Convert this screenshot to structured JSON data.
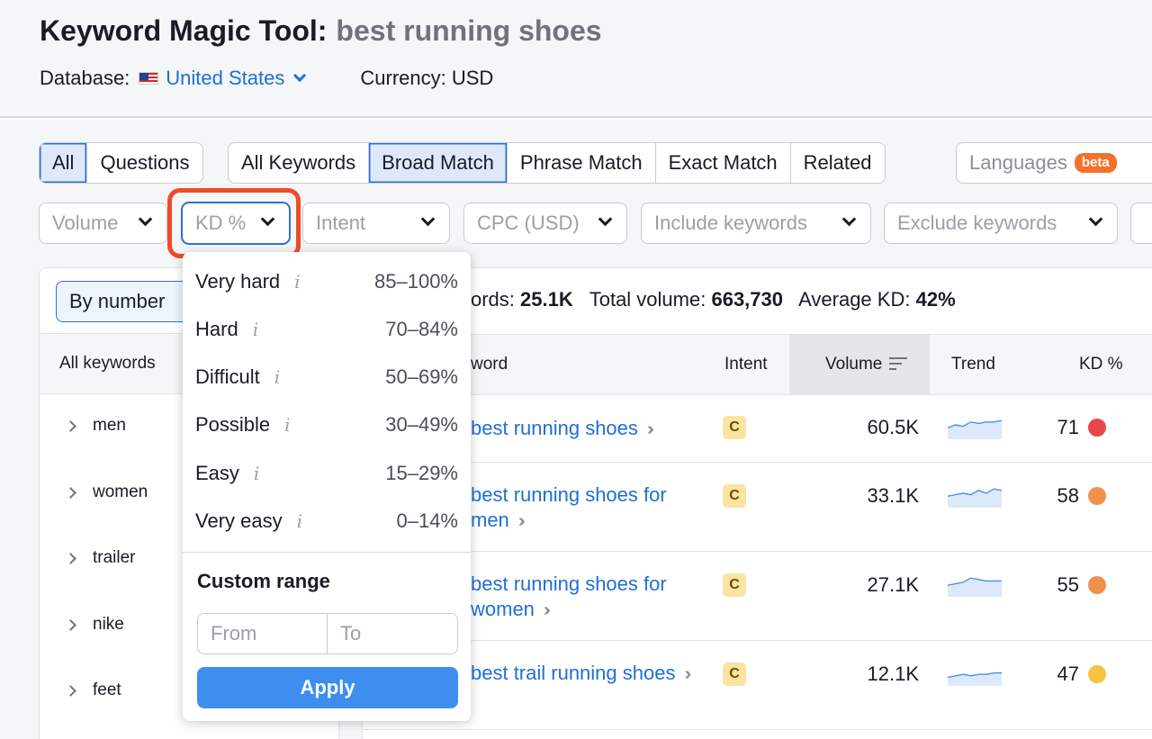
{
  "header": {
    "title": "Keyword Magic Tool:",
    "query": "best running shoes",
    "database_label": "Database:",
    "database_value": "United States",
    "currency": "Currency: USD"
  },
  "question_toggle": [
    "All",
    "Questions"
  ],
  "match_tabs": [
    "All Keywords",
    "Broad Match",
    "Phrase Match",
    "Exact Match",
    "Related"
  ],
  "languages": {
    "label": "Languages",
    "badge": "beta"
  },
  "filters": {
    "volume": "Volume",
    "kd": "KD %",
    "intent": "Intent",
    "cpc": "CPC (USD)",
    "include": "Include keywords",
    "exclude": "Exclude keywords"
  },
  "kd_dropdown": {
    "options": [
      {
        "label": "Very hard",
        "range": "85–100%"
      },
      {
        "label": "Hard",
        "range": "70–84%"
      },
      {
        "label": "Difficult",
        "range": "50–69%"
      },
      {
        "label": "Possible",
        "range": "30–49%"
      },
      {
        "label": "Easy",
        "range": "15–29%"
      },
      {
        "label": "Very easy",
        "range": "0–14%"
      }
    ],
    "info_glyph": "i",
    "custom_title": "Custom range",
    "from_placeholder": "From",
    "to_placeholder": "To",
    "apply_label": "Apply"
  },
  "left_panel": {
    "group_by": "By number",
    "all_keywords": "All keywords",
    "groups": [
      "men",
      "women",
      "trailer",
      "nike",
      "feet"
    ]
  },
  "summary": {
    "keywords_label": "ords:",
    "keywords_value": "25.1K",
    "volume_label": "Total volume:",
    "volume_value": "663,730",
    "kd_label": "Average KD:",
    "kd_value": "42%"
  },
  "table": {
    "columns": {
      "keyword": "word",
      "intent": "Intent",
      "volume": "Volume",
      "trend": "Trend",
      "kd": "KD %"
    },
    "rows": [
      {
        "keyword": "best running shoes",
        "intent": "C",
        "volume": "60.5K",
        "kd": "71",
        "kd_color": "#e8474a",
        "trend": [
          8,
          10,
          9,
          12,
          11,
          12,
          12,
          13
        ]
      },
      {
        "keyword": "best running shoes for men",
        "intent": "C",
        "volume": "33.1K",
        "kd": "58",
        "kd_color": "#f0914a",
        "trend": [
          8,
          9,
          10,
          9,
          12,
          10,
          13,
          12
        ]
      },
      {
        "keyword": "best running shoes for women",
        "intent": "C",
        "volume": "27.1K",
        "kd": "55",
        "kd_color": "#f0914a",
        "trend": [
          8,
          9,
          10,
          13,
          12,
          11,
          11,
          11
        ]
      },
      {
        "keyword": "best trail running shoes",
        "intent": "C",
        "volume": "12.1K",
        "kd": "47",
        "kd_color": "#f7c342",
        "trend": [
          6,
          7,
          8,
          7,
          8,
          8,
          9,
          9
        ]
      }
    ]
  },
  "colors": {
    "accent": "#2f6fd8",
    "highlight": "#ee4b2b",
    "link": "#1f6fd6"
  }
}
